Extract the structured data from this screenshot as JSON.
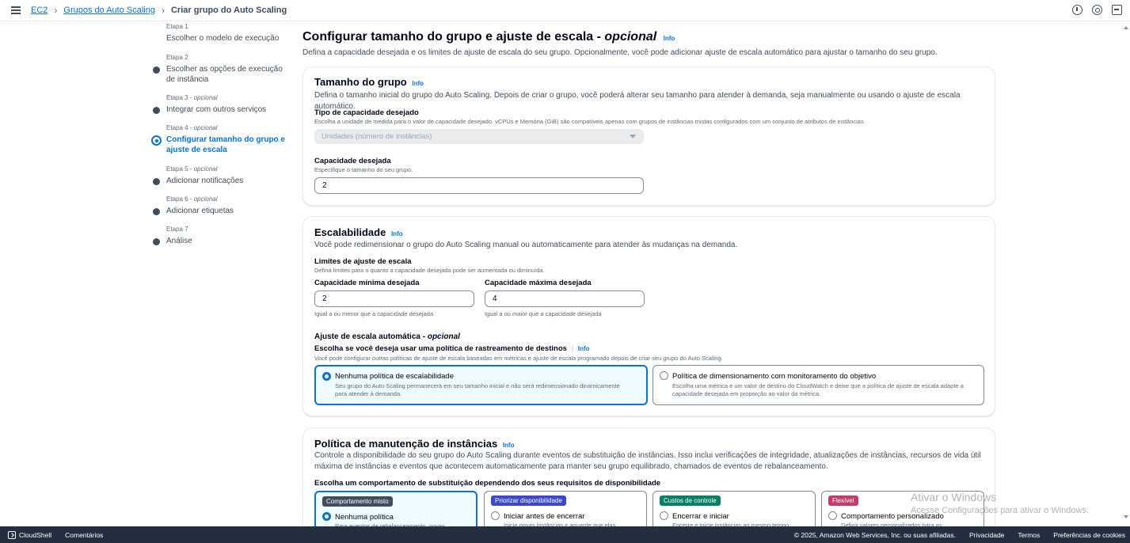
{
  "breadcrumb": {
    "ec2": "EC2",
    "groups": "Grupos do Auto Scaling",
    "current": "Criar grupo do Auto Scaling"
  },
  "steps": [
    {
      "kicker": "Etapa 1",
      "optional": "",
      "title": "Escolher o modelo de execução"
    },
    {
      "kicker": "Etapa 2",
      "optional": "",
      "title": "Escolher as opções de execução de instância"
    },
    {
      "kicker": "Etapa 3 - ",
      "optional": "opcional",
      "title": "Integrar com outros serviços"
    },
    {
      "kicker": "Etapa 4 - ",
      "optional": "opcional",
      "title": "Configurar tamanho do grupo e ajuste de escala"
    },
    {
      "kicker": "Etapa 5 - ",
      "optional": "opcional",
      "title": "Adicionar notificações"
    },
    {
      "kicker": "Etapa 6 - ",
      "optional": "opcional",
      "title": "Adicionar etiquetas"
    },
    {
      "kicker": "Etapa 7",
      "optional": "",
      "title": "Análise"
    }
  ],
  "info_label": "Info",
  "page": {
    "title": "Configurar tamanho do grupo e ajuste de escala - ",
    "title_optional": "opcional",
    "description": "Defina a capacidade desejada e os limites de ajuste de escala do seu grupo. Opcionalmente, você pode adicionar ajuste de escala automático para ajustar o tamanho do seu grupo."
  },
  "group_size": {
    "title": "Tamanho do grupo",
    "description": "Defina o tamanho inicial do grupo do Auto Scaling. Depois de criar o grupo, você poderá alterar seu tamanho para atender à demanda, seja manualmente ou usando o ajuste de escala automático.",
    "capacity_type_label": "Tipo de capacidade desejado",
    "capacity_type_hint": "Escolha a unidade de medida para o valor de capacidade desejado. vCPUs e Memória (GiB) são compatíveis apenas com grupos de instâncias mistas configurados com um conjunto de atributos de instâncias.",
    "capacity_type_value": "Unidades (número de instâncias)",
    "desired_label": "Capacidade desejada",
    "desired_hint": "Especifique o tamanho do seu grupo.",
    "desired_value": "2"
  },
  "scaling": {
    "title": "Escalabilidade",
    "description": "Você pode redimensionar o grupo do Auto Scaling manual ou automaticamente para atender às mudanças na demanda.",
    "limits_label": "Limites de ajuste de escala",
    "limits_hint": "Defina limites para o quanto a capacidade desejada pode ser aumentada ou diminuída.",
    "min_label": "Capacidade mínima desejada",
    "min_value": "2",
    "min_hint": "Igual a ou menor que a capacidade desejada",
    "max_label": "Capacidade máxima desejada",
    "max_value": "4",
    "max_hint": "Igual a ou maior que a capacidade desejada",
    "auto_label": "Ajuste de escala automática - ",
    "auto_optional": "opcional",
    "policy_question": "Escolha se você deseja usar uma política de rastreamento de destinos",
    "policy_hint": "Você pode configurar outras políticas de ajuste de escala baseadas em métricas e ajuste de escala programado depois de criar seu grupo do Auto Scaling.",
    "option_none_title": "Nenhuma política de escalabilidade",
    "option_none_desc": "Seu grupo do Auto Scaling permanecerá em seu tamanho inicial e não será redimensionado dinamicamente para atender à demanda.",
    "option_target_title": "Política de dimensionamento com monitoramento do objetivo",
    "option_target_desc": "Escolha uma métrica e um valor de destino do CloudWatch e deixe que a política de ajuste de escala adapte a capacidade desejada em proporção ao valor da métrica."
  },
  "maintenance": {
    "title": "Política de manutenção de instâncias",
    "description": "Controle a disponibilidade do seu grupo do Auto Scaling durante eventos de substituição de instâncias. Isso inclui verificações de integridade, atualizações de instâncias, recursos de vida útil máxima de instâncias e eventos que acontecem automaticamente para manter seu grupo equilibrado, chamados de eventos de rebalanceamento.",
    "choose_label": "Escolha um comportamento de substituição dependendo dos seus requisitos de disponibilidade",
    "options": [
      {
        "badge": "Comportamento misto",
        "badge_color": "#414d5c",
        "title": "Nenhuma política",
        "desc": "Para eventos de rebalanceamento, novas"
      },
      {
        "badge": "Priorizar disponibilidade",
        "badge_color": "#3b48cc",
        "title": "Iniciar antes de encerrar",
        "desc": "Inicie novas instâncias e aguarde que elas"
      },
      {
        "badge": "Custos de controle",
        "badge_color": "#067f68",
        "title": "Encerrar e iniciar",
        "desc": "Encerre e inicie instâncias ao mesmo tempo"
      },
      {
        "badge": "Flexível",
        "badge_color": "#c33d69",
        "title": "Comportamento personalizado",
        "desc": "Defina valores personalizados para as"
      }
    ]
  },
  "watermark": {
    "line1": "Ativar o Windows",
    "line2": "Acesse Configurações para ativar o Windows."
  },
  "footer": {
    "cloudshell": "CloudShell",
    "comments": "Comentários",
    "copyright": "© 2025, Amazon Web Services, Inc. ou suas afiliadas.",
    "privacy": "Privacidade",
    "terms": "Termos",
    "cookies": "Preferências de cookies"
  },
  "colors": {
    "link": "#0972d3",
    "text": "#000716",
    "footer_bg": "#232f3e"
  }
}
